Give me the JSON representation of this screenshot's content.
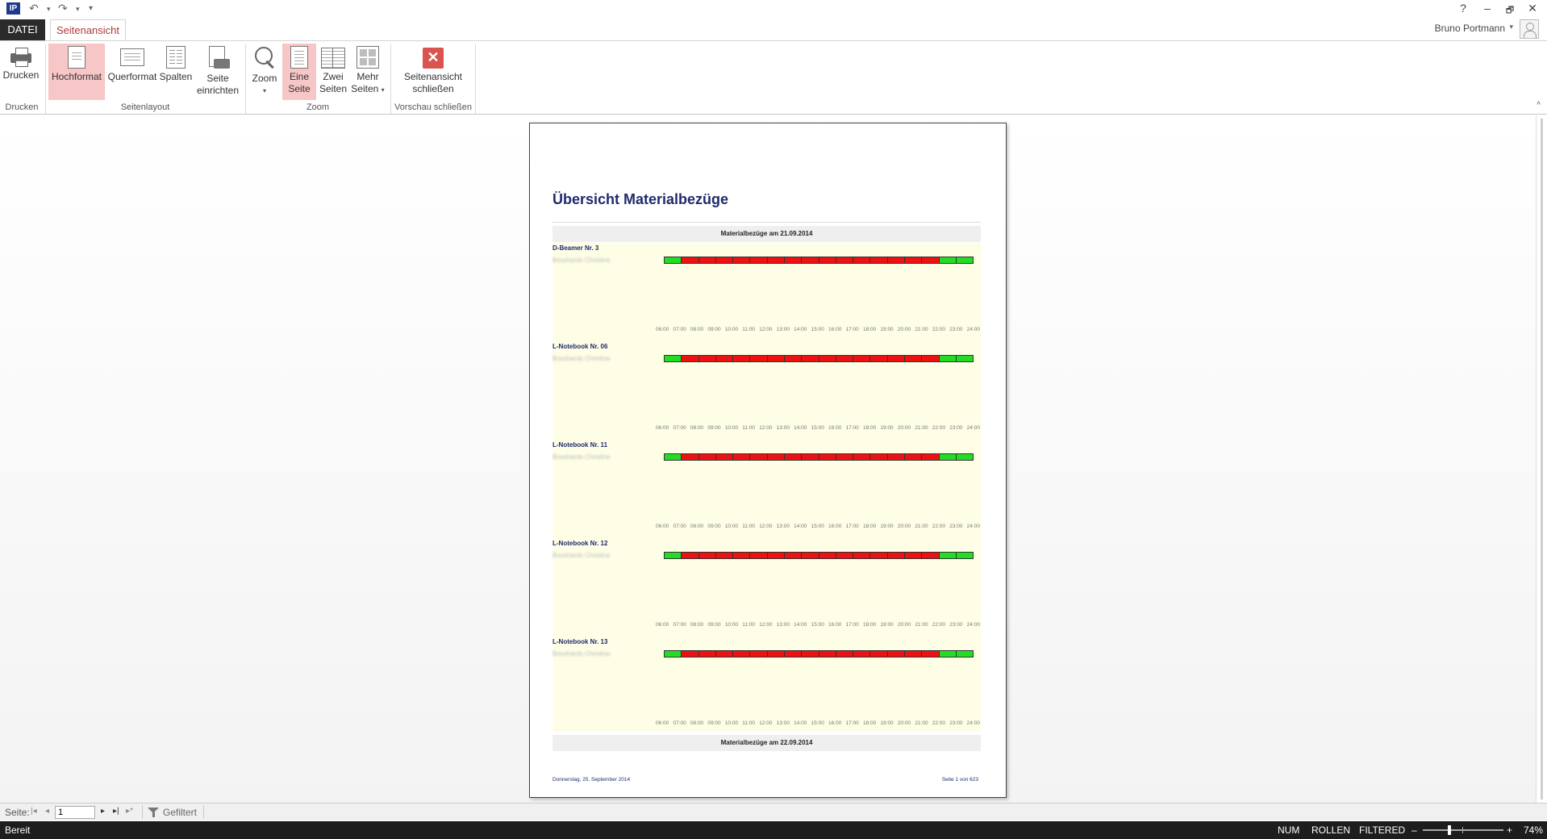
{
  "quick_access": {
    "logo": "IP",
    "undo": "↶",
    "redo": "↷",
    "customize": "▾"
  },
  "window": {
    "help": "?",
    "minimize": "–",
    "restore": "🗗",
    "close": "✕"
  },
  "tabs": {
    "file": "DATEI",
    "active": "Seitenansicht"
  },
  "user": {
    "name": "Bruno Portmann",
    "caret": "▾"
  },
  "ribbon": {
    "buttons": {
      "print": "Drucken",
      "portrait": "Hochformat",
      "landscape": "Querformat",
      "columns": "Spalten",
      "setup_1": "Seite",
      "setup_2": "einrichten",
      "zoom": "Zoom",
      "one_page_1": "Eine",
      "one_page_2": "Seite",
      "two_pages_1": "Zwei",
      "two_pages_2": "Seiten",
      "more_pages_1": "Mehr",
      "more_pages_2": "Seiten",
      "close_1": "Seitenansicht",
      "close_2": "schließen"
    },
    "groups": {
      "print": "Drucken",
      "layout": "Seitenlayout",
      "zoom": "Zoom",
      "close": "Vorschau schließen"
    },
    "collapse": "^",
    "close_glyph": "✕"
  },
  "report": {
    "title": "Übersicht Materialbezüge",
    "day1": "Materialbezüge am 21.09.2014",
    "day2": "Materialbezüge am 22.09.2014",
    "devices": [
      {
        "name": "D-Beamer Nr. 3",
        "user": "Bosshards Christine"
      },
      {
        "name": "L-Notebook Nr. 06",
        "user": "Bosshards Christine"
      },
      {
        "name": "L-Notebook Nr. 11",
        "user": "Bosshards Christine"
      },
      {
        "name": "L-Notebook Nr. 12",
        "user": "Bosshards Christine"
      },
      {
        "name": "L-Notebook Nr. 13",
        "user": "Bosshards Christine"
      }
    ],
    "hours": [
      "06:00",
      "07:00",
      "08:00",
      "09:00",
      "10:00",
      "11:00",
      "12:00",
      "13:00",
      "14:00",
      "15:00",
      "16:00",
      "17:00",
      "18:00",
      "19:00",
      "20:00",
      "21:00",
      "22:00",
      "23:00",
      "24:00"
    ],
    "slot_status": [
      "free",
      "busy",
      "busy",
      "busy",
      "busy",
      "busy",
      "busy",
      "busy",
      "busy",
      "busy",
      "busy",
      "busy",
      "busy",
      "busy",
      "busy",
      "busy",
      "free",
      "free"
    ],
    "colors": {
      "free": "#22dd22",
      "busy": "#ee1111"
    },
    "footer_left": "Donnerstag, 25. September 2014",
    "footer_right": "Seite 1 von 623"
  },
  "navigation": {
    "label": "Seite:",
    "current_page": "1",
    "first": "|◂",
    "prev": "◂",
    "next": "▸",
    "last": "▸|",
    "new": "▸*",
    "filter": "Gefiltert"
  },
  "status": {
    "ready": "Bereit",
    "num": "NUM",
    "scroll": "ROLLEN",
    "filtered": "FILTERED",
    "zoom_minus": "–",
    "zoom_plus": "+",
    "zoom_level": "74%"
  }
}
